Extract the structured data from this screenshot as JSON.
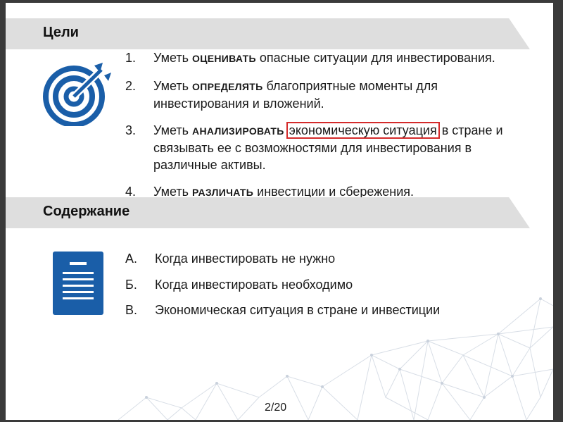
{
  "sections": {
    "goals_title": "Цели",
    "content_title": "Содержание"
  },
  "goals": [
    {
      "num": "1.",
      "pre": "Уметь ",
      "kw": "ОЦЕНИВАТЬ",
      "post": " опасные ситуации для инвестирования."
    },
    {
      "num": "2.",
      "pre": "Уметь ",
      "kw": "ОПРЕДЕЛЯТЬ",
      "post": "  благоприятные моменты для инвестирования и вложений."
    },
    {
      "num": "3.",
      "pre": "Уметь ",
      "kw": "АНАЛИЗИРОВАТЬ",
      "hl": "экономическую ситуация",
      "post": " в стране и связывать ее с возможностями для инвестирования в различные активы."
    },
    {
      "num": "4.",
      "pre": "Уметь ",
      "kw": "РАЗЛИЧАТЬ",
      "post": "  инвестиции и сбережения."
    }
  ],
  "content_items": [
    {
      "num": "А.",
      "text": "Когда инвестировать не нужно"
    },
    {
      "num": "Б.",
      "text": "Когда инвестировать необходимо"
    },
    {
      "num": "В.",
      "text": "Экономическая ситуация в стране и инвестиции"
    }
  ],
  "page_number": "2/20",
  "colors": {
    "accent": "#1a5ea8",
    "highlight": "#d42a2a",
    "banner": "#dedede"
  },
  "icons": {
    "goals": "target-icon",
    "content": "document-icon"
  }
}
